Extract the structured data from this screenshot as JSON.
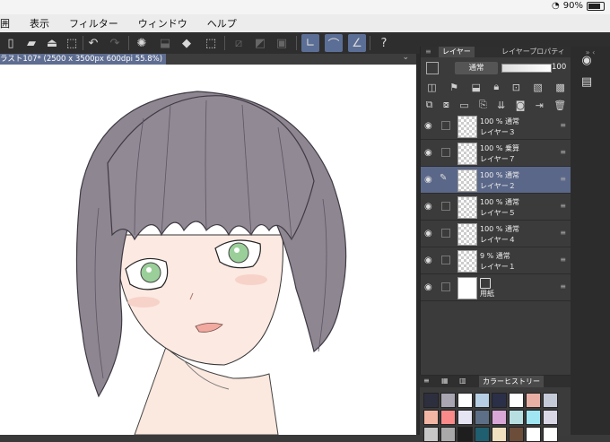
{
  "status": {
    "battery": "90%"
  },
  "menu": {
    "items": [
      "囲",
      "表示",
      "フィルター",
      "ウィンドウ",
      "ヘルプ"
    ]
  },
  "toolbar": {
    "icons": [
      "new-file-icon",
      "open-folder-icon",
      "save-icon",
      "undo-icon",
      "redo-icon",
      "loading-icon",
      "transform-icon",
      "fill-icon",
      "selection-icon",
      "snap-icon",
      "ruler-icon",
      "grid-icon",
      "pen-icon",
      "brush-icon",
      "line-icon",
      "help-icon"
    ]
  },
  "tab": {
    "title": "ラスト107* (2500 x 3500px 600dpi 55.8%)"
  },
  "layer_panel": {
    "tab_layer": "レイヤー",
    "tab_property": "レイヤープロパティ",
    "blend_mode": "通常",
    "opacity": "100"
  },
  "layers": [
    {
      "mode": "100 % 通常",
      "name": "レイヤー３",
      "active": false,
      "thumb": "checker"
    },
    {
      "mode": "100 % 乗算",
      "name": "レイヤー７",
      "active": false,
      "thumb": "checker"
    },
    {
      "mode": "100 % 通常",
      "name": "レイヤー２",
      "active": true,
      "thumb": "checker"
    },
    {
      "mode": "100 % 通常",
      "name": "レイヤー５",
      "active": false,
      "thumb": "checker"
    },
    {
      "mode": "100 % 通常",
      "name": "レイヤー４",
      "active": false,
      "thumb": "checker"
    },
    {
      "mode": "9 % 通常",
      "name": "レイヤー１",
      "active": false,
      "thumb": "checker"
    },
    {
      "mode": "",
      "name": "用紙",
      "active": false,
      "thumb": "white"
    }
  ],
  "color_history": {
    "title": "カラーヒストリー",
    "swatches": [
      "#2d2f3e",
      "#a9a6b2",
      "#ffffff",
      "#b6cfe4",
      "#2b2f47",
      "#ffffff",
      "#e8b0a5",
      "#c5cad9",
      "#f3b6a4",
      "#fa8a8a",
      "#e4e4f2",
      "#5d6f86",
      "#d9a7d6",
      "#b7dfe2",
      "#9fe6f2",
      "#d9d6e6",
      "#c7c7c7",
      "#a9a9a9",
      "#1e1e1e",
      "#1f5f6f",
      "#f0e0c0",
      "#6b4d3a",
      "#ffffff",
      "#ffffff"
    ]
  }
}
